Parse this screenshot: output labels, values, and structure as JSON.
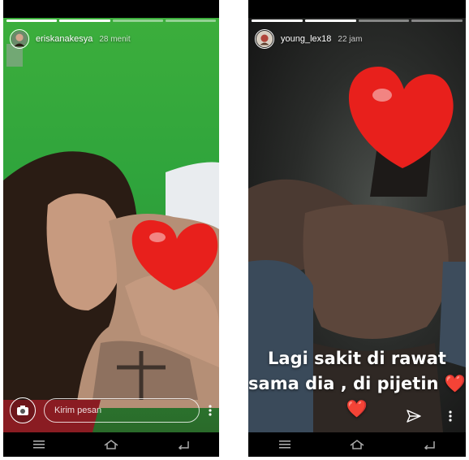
{
  "left_story": {
    "username": "eriskanakesya",
    "time": "28 menit",
    "reply_placeholder": "Kirim pesan"
  },
  "right_story": {
    "username": "young_lex18",
    "time": "22 jam",
    "caption_line1": "Lagi sakit di rawat",
    "caption_line2": "sama dia , di pijetin",
    "caption_emoji": "❤️❤️"
  },
  "icons": {
    "camera": "camera-icon",
    "share": "send-icon",
    "more": "more-vertical-icon",
    "nav_menu": "menu-icon",
    "nav_home": "home-icon",
    "nav_back": "back-icon",
    "sticker": "heart-sticker-icon"
  },
  "colors": {
    "heart": "#e8201c",
    "left_background": "#34a63c",
    "right_background": "#2a2c2a"
  }
}
